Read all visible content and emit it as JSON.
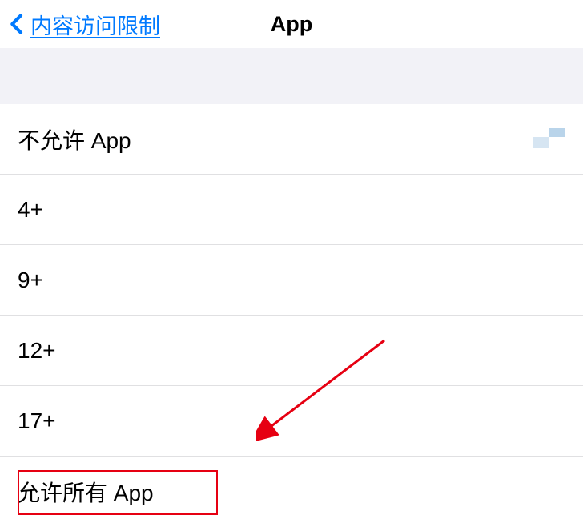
{
  "header": {
    "back_label": "内容访问限制",
    "title": "App"
  },
  "options": [
    {
      "label": "不允许 App",
      "mark": true
    },
    {
      "label": "4+",
      "mark": false
    },
    {
      "label": "9+",
      "mark": false
    },
    {
      "label": "12+",
      "mark": false
    },
    {
      "label": "17+",
      "mark": false
    },
    {
      "label": "允许所有 App",
      "mark": false
    }
  ],
  "annotation": {
    "highlight_target": "允许所有 App"
  }
}
